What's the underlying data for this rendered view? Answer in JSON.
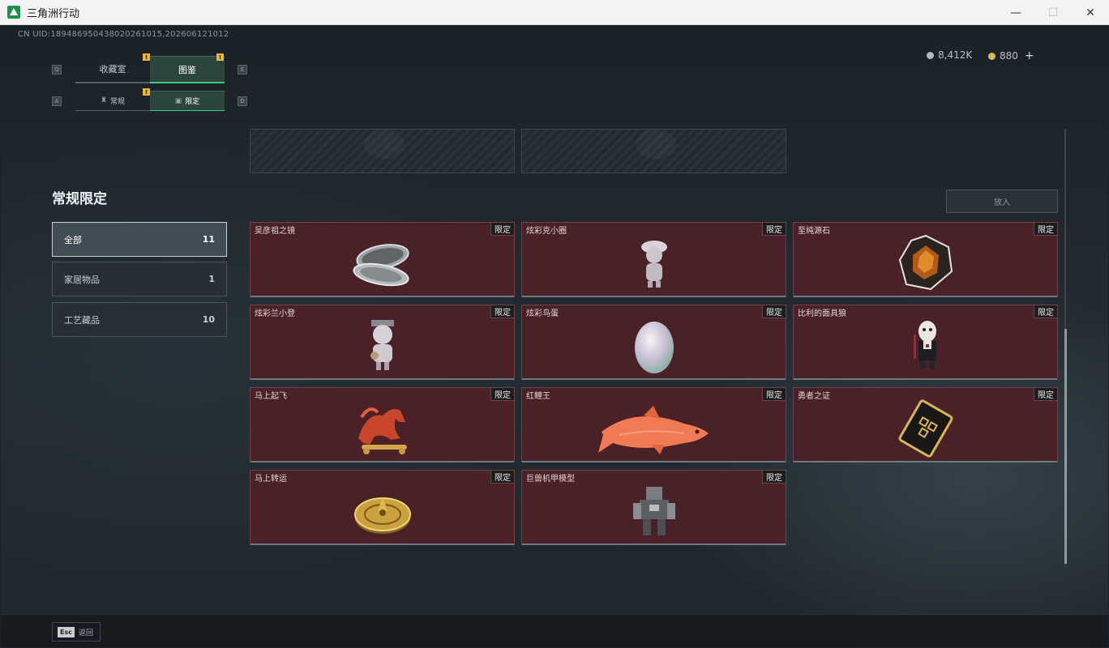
{
  "window": {
    "title": "三角洲行动",
    "minimize": "—",
    "maximize": "☐",
    "close": "✕"
  },
  "header": {
    "uid": "CN UID:1894869504380202610​15,202606121012",
    "currency": [
      {
        "value": "8,412K",
        "color": "#b0b8bd"
      },
      {
        "value": "880",
        "color": "#d8b65a"
      }
    ],
    "plus": "+"
  },
  "tabs": {
    "main": [
      {
        "label": "收藏室",
        "active": false,
        "alert": "!"
      },
      {
        "label": "图鉴",
        "active": true,
        "alert": "!"
      }
    ],
    "main_keys": {
      "left": "Q",
      "right": "E"
    },
    "sub": [
      {
        "label": "常规",
        "icon": "♜",
        "active": false,
        "alert": "!"
      },
      {
        "label": "限定",
        "icon": "▣",
        "active": true
      }
    ],
    "sub_keys": {
      "left": "A",
      "right": "D"
    }
  },
  "sidebar": {
    "title": "常规限定",
    "filters": [
      {
        "label": "全部",
        "count": "11",
        "active": true
      },
      {
        "label": "家居物品",
        "count": "1",
        "active": false
      },
      {
        "label": "工艺藏品",
        "count": "10",
        "active": false
      }
    ]
  },
  "put_in_button": "放入",
  "items": [
    {
      "name": "吴彦祖之镜",
      "tag": "限定",
      "icon": "mirror-compact-icon"
    },
    {
      "name": "炫彩克小圈",
      "tag": "限定",
      "icon": "figurine-icon"
    },
    {
      "name": "至纯源石",
      "tag": "限定",
      "icon": "gem-stone-icon"
    },
    {
      "name": "炫彩兰小登",
      "tag": "限定",
      "icon": "doll-figurine-icon"
    },
    {
      "name": "炫彩鸟蛋",
      "tag": "限定",
      "icon": "egg-icon"
    },
    {
      "name": "比利的面具狼",
      "tag": "限定",
      "icon": "puppet-icon"
    },
    {
      "name": "马上起飞",
      "tag": "限定",
      "icon": "horse-statue-icon"
    },
    {
      "name": "红鲤王",
      "tag": "限定",
      "icon": "koi-fish-icon"
    },
    {
      "name": "勇者之证",
      "tag": "限定",
      "icon": "badge-card-icon"
    },
    {
      "name": "马上转运",
      "tag": "限定",
      "icon": "golden-disc-icon"
    },
    {
      "name": "巨兽机甲模型",
      "tag": "限定",
      "icon": "mech-model-icon"
    }
  ],
  "footer": {
    "esc_key": "Esc",
    "back_label": "返回"
  }
}
